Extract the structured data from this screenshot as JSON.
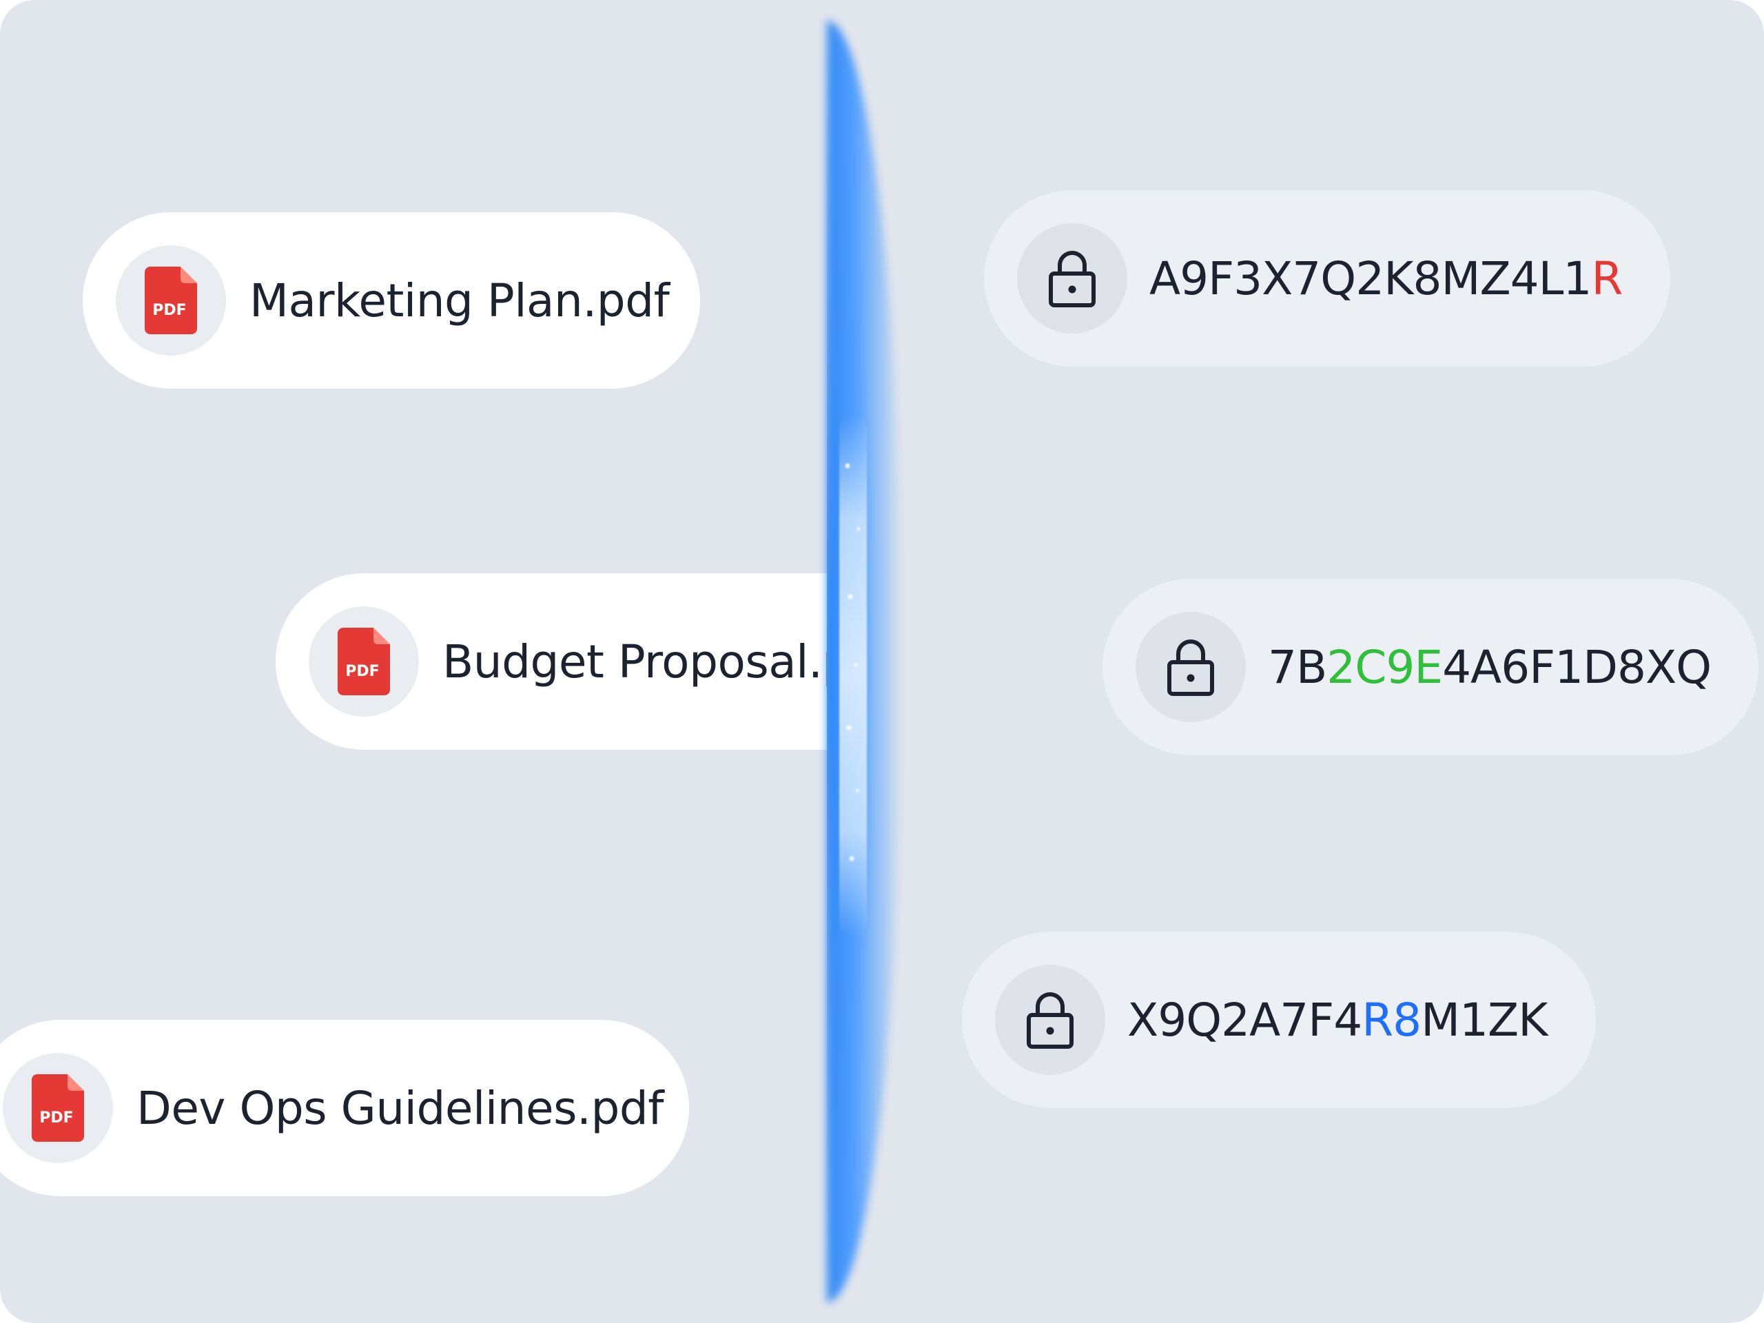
{
  "files": [
    {
      "name": "Marketing Plan.pdf",
      "icon": "pdf-file-icon",
      "icon_label": "PDF"
    },
    {
      "name": "Budget Proposal.pdf",
      "icon": "pdf-file-icon",
      "icon_label": "PDF"
    },
    {
      "name": "Dev Ops Guidelines.pdf",
      "icon": "pdf-file-icon",
      "icon_label": "PDF"
    }
  ],
  "encrypted": [
    {
      "icon": "lock-icon",
      "parts": [
        {
          "text": "A9F3X7Q2K8MZ4L1"
        },
        {
          "text": "R",
          "color": "#e53935"
        },
        {
          "text": ""
        }
      ]
    },
    {
      "icon": "lock-icon",
      "parts": [
        {
          "text": "7B"
        },
        {
          "text": "2C9E",
          "color": "#2fbf3a"
        },
        {
          "text": "4A6F1D8XQ"
        }
      ]
    },
    {
      "icon": "lock-icon",
      "parts": [
        {
          "text": "X9Q2A7F4"
        },
        {
          "text": "R8",
          "color": "#1f6fff"
        },
        {
          "text": "M1ZK"
        }
      ]
    }
  ],
  "colors": {
    "background": "#e1e5ec",
    "pdf_red": "#e53935",
    "beam_blue": "#2d86f5",
    "text": "#1d2230"
  }
}
